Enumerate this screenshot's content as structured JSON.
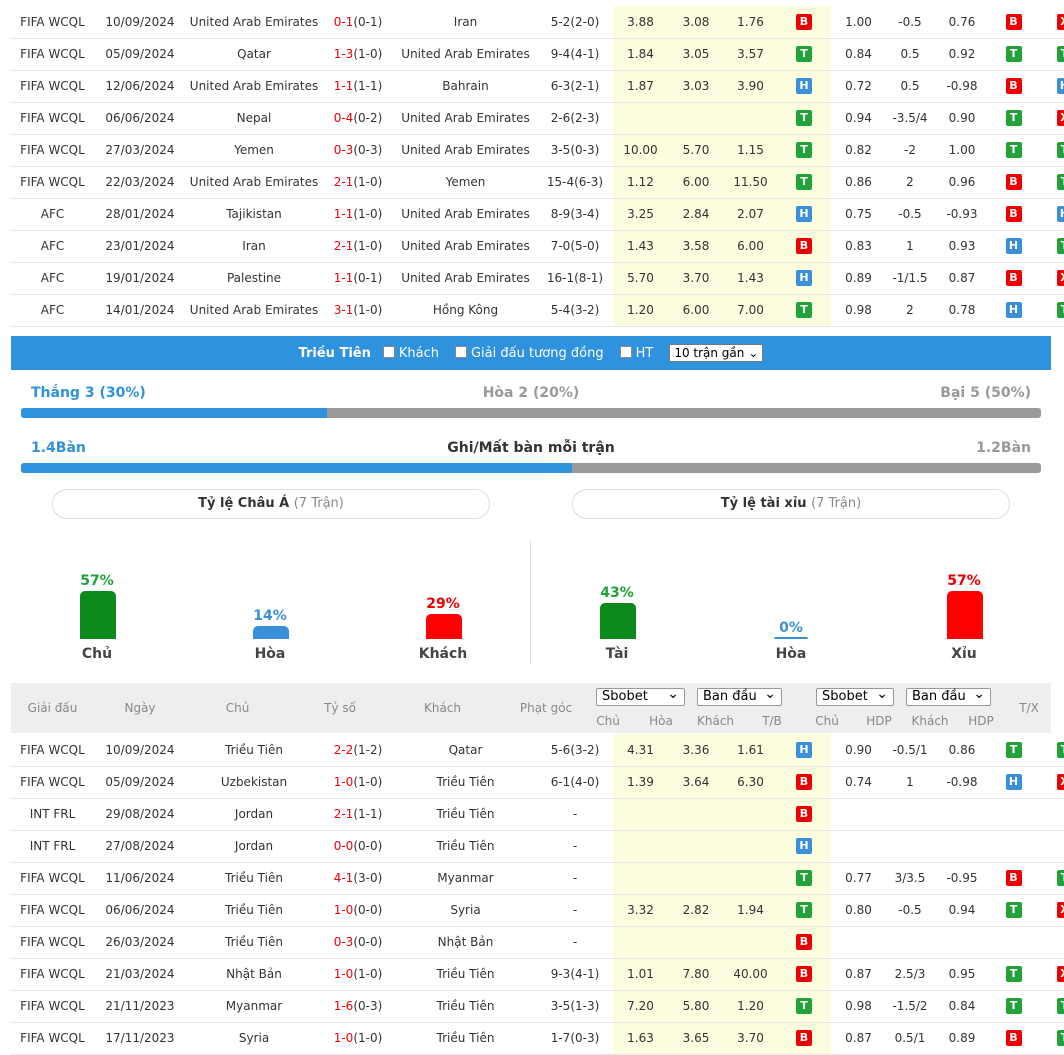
{
  "top_rows": [
    {
      "league": "FIFA WCQL",
      "date": "10/09/2024",
      "home": "United Arab Emirates",
      "home_c": "orange",
      "score": "0-1",
      "ht": "(0-1)",
      "away": "Iran",
      "away_c": "",
      "corner": "5-2(2-0)",
      "o1": "3.88",
      "o2": "3.08",
      "o3": "1.76",
      "tb": "B",
      "a1": "1.00",
      "a2": "-0.5",
      "a3": "0.76",
      "hdp": "B",
      "tx": "X"
    },
    {
      "league": "FIFA WCQL",
      "date": "05/09/2024",
      "home": "Qatar",
      "home_c": "",
      "score": "1-3",
      "ht": "(1-0)",
      "away": "United Arab Emirates",
      "away_c": "orange",
      "corner": "9-4(4-1)",
      "o1": "1.84",
      "o2": "3.05",
      "o3": "3.57",
      "tb": "T",
      "a1": "0.84",
      "a2": "0.5",
      "a3": "0.92",
      "hdp": "T",
      "tx": "T"
    },
    {
      "league": "FIFA WCQL",
      "date": "12/06/2024",
      "home": "United Arab Emirates",
      "home_c": "orange",
      "score": "1-1",
      "ht": "(1-1)",
      "away": "Bahrain",
      "away_c": "",
      "corner": "6-3(2-1)",
      "o1": "1.87",
      "o2": "3.03",
      "o3": "3.90",
      "tb": "H",
      "a1": "0.72",
      "a2": "0.5",
      "a3": "-0.98",
      "hdp": "B",
      "tx": "H"
    },
    {
      "league": "FIFA WCQL",
      "date": "06/06/2024",
      "home": "Nepal",
      "home_c": "",
      "score": "0-4",
      "ht": "(0-2)",
      "away": "United Arab Emirates",
      "away_c": "orange",
      "corner": "2-6(2-3)",
      "o1": "",
      "o2": "",
      "o3": "",
      "tb": "T",
      "a1": "0.94",
      "a2": "-3.5/4",
      "a3": "0.90",
      "hdp": "T",
      "tx": "X"
    },
    {
      "league": "FIFA WCQL",
      "date": "27/03/2024",
      "home": "Yemen",
      "home_c": "",
      "score": "0-3",
      "ht": "(0-3)",
      "away": "United Arab Emirates",
      "away_c": "orange",
      "corner": "3-5(0-3)",
      "o1": "10.00",
      "o2": "5.70",
      "o3": "1.15",
      "tb": "T",
      "a1": "0.82",
      "a2": "-2",
      "a3": "1.00",
      "hdp": "T",
      "tx": "T"
    },
    {
      "league": "FIFA WCQL",
      "date": "22/03/2024",
      "home": "United Arab Emirates",
      "home_c": "orange",
      "score": "2-1",
      "ht": "(1-0)",
      "away": "Yemen",
      "away_c": "",
      "corner": "15-4(6-3)",
      "o1": "1.12",
      "o2": "6.00",
      "o3": "11.50",
      "tb": "T",
      "a1": "0.86",
      "a2": "2",
      "a3": "0.96",
      "hdp": "B",
      "tx": "T"
    },
    {
      "league": "AFC",
      "date": "28/01/2024",
      "home": "Tajikistan",
      "home_c": "",
      "score": "1-1",
      "ht": "(1-0)",
      "away": "United Arab Emirates",
      "away_c": "orange",
      "corner": "8-9(3-4)",
      "o1": "3.25",
      "o2": "2.84",
      "o3": "2.07",
      "tb": "H",
      "a1": "0.75",
      "a2": "-0.5",
      "a3": "-0.93",
      "hdp": "B",
      "tx": "H"
    },
    {
      "league": "AFC",
      "date": "23/01/2024",
      "home": "Iran",
      "home_c": "",
      "score": "2-1",
      "ht": "(1-0)",
      "away": "United Arab Emirates",
      "away_c": "orange",
      "corner": "7-0(5-0)",
      "o1": "1.43",
      "o2": "3.58",
      "o3": "6.00",
      "tb": "B",
      "a1": "0.83",
      "a2": "1",
      "a3": "0.93",
      "hdp": "H",
      "tx": "T"
    },
    {
      "league": "AFC",
      "date": "19/01/2024",
      "home": "Palestine",
      "home_c": "",
      "score": "1-1",
      "ht": "(0-1)",
      "away": "United Arab Emirates",
      "away_c": "orange",
      "corner": "16-1(8-1)",
      "o1": "5.70",
      "o2": "3.70",
      "o3": "1.43",
      "tb": "H",
      "a1": "0.89",
      "a2": "-1/1.5",
      "a3": "0.87",
      "hdp": "B",
      "tx": "X"
    },
    {
      "league": "AFC",
      "date": "14/01/2024",
      "home": "United Arab Emirates",
      "home_c": "orange",
      "score": "3-1",
      "ht": "(1-0)",
      "away": "Hồng Kông",
      "away_c": "",
      "corner": "5-4(3-2)",
      "o1": "1.20",
      "o2": "6.00",
      "o3": "7.00",
      "tb": "T",
      "a1": "0.98",
      "a2": "2",
      "a3": "0.78",
      "hdp": "H",
      "tx": "T"
    }
  ],
  "team_bar": {
    "team": "Triều Tiên",
    "opt_away": "Khách",
    "opt_same": "Giải đấu tương đồng",
    "opt_ht": "HT",
    "select": "10 trận gần"
  },
  "summary": {
    "win": "Thắng 3 (30%)",
    "draw": "Hòa 2 (20%)",
    "loss": "Bại 5 (50%)",
    "win_fraction": 0.3
  },
  "goals": {
    "left": "1.4Bàn",
    "title": "Ghi/Mất bàn mỗi trận",
    "right": "1.2Bàn",
    "left_fraction": 0.54
  },
  "asia": {
    "title": "Tỷ lệ Châu Á",
    "sub": "(7 Trận)",
    "home_pct": "57%",
    "draw_pct": "14%",
    "away_pct": "29%",
    "home_lbl": "Chủ",
    "draw_lbl": "Hòa",
    "away_lbl": "Khách"
  },
  "ou": {
    "title": "Tỷ lệ tài xỉu",
    "sub": "(7 Trận)",
    "over_pct": "43%",
    "draw_pct": "0%",
    "under_pct": "57%",
    "over_lbl": "Tài",
    "draw_lbl": "Hòa",
    "under_lbl": "Xỉu"
  },
  "header": {
    "league": "Giải đấu",
    "date": "Ngày",
    "home": "Chủ",
    "score": "Tỷ số",
    "away": "Khách",
    "corner": "Phạt góc",
    "sel1": "Sbobet",
    "sel2": "Ban đầu",
    "sel3": "Sbobet",
    "sel4": "Ban đầu",
    "c1": "Chủ",
    "c2": "Hòa",
    "c3": "Khách",
    "c4": "T/B",
    "c5": "Chủ",
    "c6": "HDP",
    "c7": "Khách",
    "c8": "HDP",
    "c9": "T/X"
  },
  "bottom_rows": [
    {
      "league": "FIFA WCQL",
      "date": "10/09/2024",
      "home": "Triều Tiên",
      "home_c": "blue",
      "score": "2-2",
      "ht": "(1-2)",
      "away": "Qatar",
      "away_c": "",
      "corner": "5-6(3-2)",
      "o1": "4.31",
      "o2": "3.36",
      "o3": "1.61",
      "tb": "H",
      "a1": "0.90",
      "a2": "-0.5/1",
      "a3": "0.86",
      "hdp": "T",
      "tx": "T"
    },
    {
      "league": "FIFA WCQL",
      "date": "05/09/2024",
      "home": "Uzbekistan",
      "home_c": "",
      "score": "1-0",
      "ht": "(1-0)",
      "away": "Triều Tiên",
      "away_c": "blue",
      "corner": "6-1(4-0)",
      "o1": "1.39",
      "o2": "3.64",
      "o3": "6.30",
      "tb": "B",
      "a1": "0.74",
      "a2": "1",
      "a3": "-0.98",
      "hdp": "H",
      "tx": "X"
    },
    {
      "league": "INT FRL",
      "date": "29/08/2024",
      "home": "Jordan",
      "home_c": "",
      "score": "2-1",
      "ht": "(1-1)",
      "away": "Triều Tiên",
      "away_c": "blue",
      "corner": "-",
      "o1": "",
      "o2": "",
      "o3": "",
      "tb": "B",
      "a1": "",
      "a2": "",
      "a3": "",
      "hdp": "",
      "tx": ""
    },
    {
      "league": "INT FRL",
      "date": "27/08/2024",
      "home": "Jordan",
      "home_c": "",
      "score": "0-0",
      "ht": "(0-0)",
      "away": "Triều Tiên",
      "away_c": "blue",
      "corner": "-",
      "o1": "",
      "o2": "",
      "o3": "",
      "tb": "H",
      "a1": "",
      "a2": "",
      "a3": "",
      "hdp": "",
      "tx": ""
    },
    {
      "league": "FIFA WCQL",
      "date": "11/06/2024",
      "home": "Triều Tiên",
      "home_c": "blue",
      "score": "4-1",
      "ht": "(3-0)",
      "away": "Myanmar",
      "away_c": "",
      "corner": "-",
      "o1": "",
      "o2": "",
      "o3": "",
      "tb": "T",
      "a1": "0.77",
      "a2": "3/3.5",
      "a3": "-0.95",
      "hdp": "B",
      "tx": "T"
    },
    {
      "league": "FIFA WCQL",
      "date": "06/06/2024",
      "home": "Triều Tiên",
      "home_c": "blue",
      "score": "1-0",
      "ht": "(0-0)",
      "away": "Syria",
      "away_c": "",
      "corner": "-",
      "o1": "3.32",
      "o2": "2.82",
      "o3": "1.94",
      "tb": "T",
      "a1": "0.80",
      "a2": "-0.5",
      "a3": "0.94",
      "hdp": "T",
      "tx": "X"
    },
    {
      "league": "FIFA WCQL",
      "date": "26/03/2024",
      "home": "Triều Tiên",
      "home_c": "blue",
      "score": "0-3",
      "ht": "(0-0)",
      "away": "Nhật Bản",
      "away_c": "",
      "corner": "-",
      "o1": "",
      "o2": "",
      "o3": "",
      "tb": "B",
      "a1": "",
      "a2": "",
      "a3": "",
      "hdp": "",
      "tx": ""
    },
    {
      "league": "FIFA WCQL",
      "date": "21/03/2024",
      "home": "Nhật Bản",
      "home_c": "",
      "score": "1-0",
      "ht": "(1-0)",
      "away": "Triều Tiên",
      "away_c": "blue",
      "corner": "9-3(4-1)",
      "o1": "1.01",
      "o2": "7.80",
      "o3": "40.00",
      "tb": "B",
      "a1": "0.87",
      "a2": "2.5/3",
      "a3": "0.95",
      "hdp": "T",
      "tx": "X"
    },
    {
      "league": "FIFA WCQL",
      "date": "21/11/2023",
      "home": "Myanmar",
      "home_c": "",
      "score": "1-6",
      "ht": "(0-3)",
      "away": "Triều Tiên",
      "away_c": "blue",
      "corner": "3-5(1-3)",
      "o1": "7.20",
      "o2": "5.80",
      "o3": "1.20",
      "tb": "T",
      "a1": "0.98",
      "a2": "-1.5/2",
      "a3": "0.84",
      "hdp": "T",
      "tx": "T"
    },
    {
      "league": "FIFA WCQL",
      "date": "17/11/2023",
      "home": "Syria",
      "home_c": "",
      "score": "1-0",
      "ht": "(1-0)",
      "away": "Triều Tiên",
      "away_c": "blue",
      "corner": "1-7(0-3)",
      "o1": "1.63",
      "o2": "3.65",
      "o3": "3.70",
      "tb": "B",
      "a1": "0.87",
      "a2": "0.5/1",
      "a3": "0.89",
      "hdp": "B",
      "tx": "T"
    }
  ]
}
